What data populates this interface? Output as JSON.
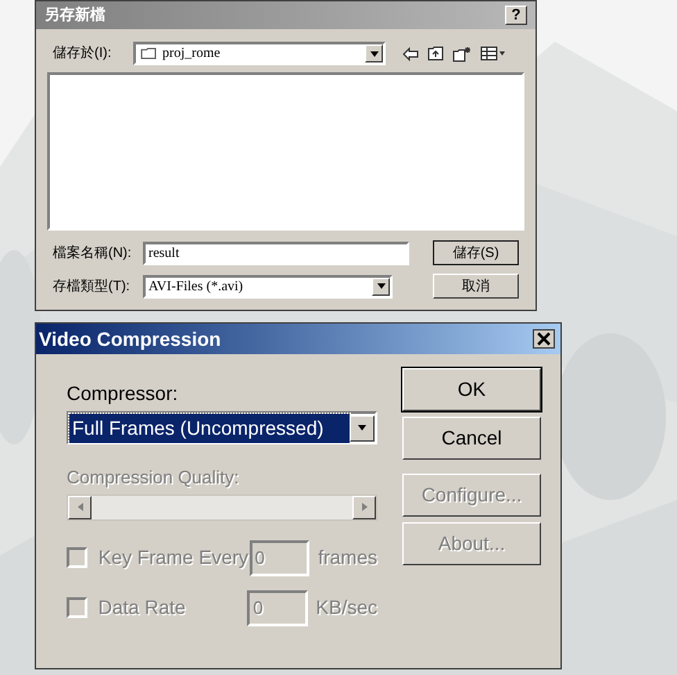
{
  "save_dialog": {
    "title": "另存新檔",
    "help_button": "?",
    "save_in": {
      "label": "儲存於(I):",
      "value": "proj_rome"
    },
    "file_name": {
      "label": "檔案名稱(N):",
      "value": "result"
    },
    "file_type": {
      "label": "存檔類型(T):",
      "value": "AVI-Files (*.avi)"
    },
    "buttons": [
      "儲存(S)",
      "取消"
    ]
  },
  "video_dialog": {
    "title": "Video Compression",
    "compressor": {
      "label": "Compressor:",
      "value": "Full Frames (Uncompressed)",
      "selected": true
    },
    "quality": {
      "label": "Compression Quality:",
      "disabled": true
    },
    "buttons": [
      {
        "label": "OK",
        "disabled": false,
        "default": true
      },
      {
        "label": "Cancel",
        "disabled": false,
        "default": false
      },
      {
        "label": "Configure...",
        "disabled": true,
        "default": false
      },
      {
        "label": "About...",
        "disabled": true,
        "default": false
      }
    ],
    "options": [
      {
        "kind": "checkbox",
        "label": "Key Frame Every",
        "checked": false,
        "disabled": true,
        "value": "0",
        "unit": "frames"
      },
      {
        "kind": "checkbox",
        "label": "Data Rate",
        "checked": false,
        "disabled": true,
        "value": "0",
        "unit": "KB/sec"
      }
    ]
  }
}
